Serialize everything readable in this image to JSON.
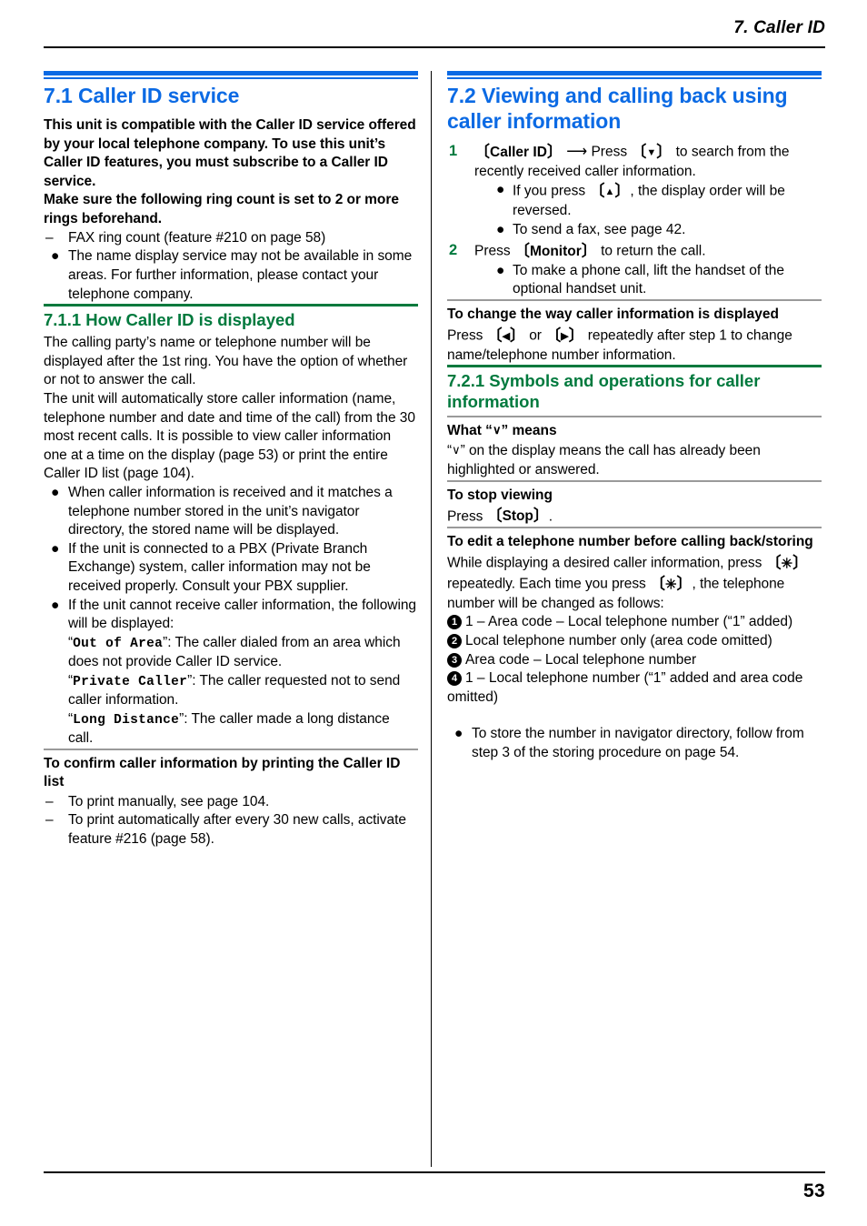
{
  "header": {
    "chapter": "7. Caller ID"
  },
  "footer": {
    "page_number": "53"
  },
  "colors": {
    "section_blue": "#0b6ae4",
    "subsection_green": "#00793d",
    "rule_gray": "#9a9a9a",
    "text_black": "#000000"
  },
  "left_column": {
    "section": {
      "title": "7.1 Caller ID service",
      "intro_bold_1": "This unit is compatible with the Caller ID service offered by your local telephone company. To use this unit’s Caller ID features, you must subscribe to a Caller ID service.",
      "intro_bold_2": "Make sure the following ring count is set to 2 or more rings beforehand.",
      "dash_item": "FAX ring count (feature #210 on page 58)",
      "bullet_item": "The name display service may not be available in some areas. For further information, please contact your telephone company."
    },
    "subsection": {
      "title": "7.1.1 How Caller ID is displayed",
      "para_1": "The calling party’s name or telephone number will be displayed after the 1st ring. You have the option of whether or not to answer the call.",
      "para_2": "The unit will automatically store caller information (name, telephone number and date and time of the call) from the 30 most recent calls. It is possible to view caller information one at a time on the display (page 53) or print the entire Caller ID list (page 104).",
      "bullets": [
        "When caller information is received and it matches a telephone number stored in the unit’s navigator directory, the stored name will be displayed.",
        "If the unit is connected to a PBX (Private Branch Exchange) system, caller information may not be received properly. Consult your PBX supplier."
      ],
      "bullet_3_lead": "If the unit cannot receive caller information, the following will be displayed:",
      "display_messages": [
        {
          "code": "Out of Area",
          "desc": "”: The caller dialed from an area which does not provide Caller ID service."
        },
        {
          "code": "Private Caller",
          "desc": "”: The caller requested not to send caller information."
        },
        {
          "code": "Long Distance",
          "desc": "”: The caller made a long distance call."
        }
      ]
    },
    "print_block": {
      "heading": "To confirm caller information by printing the Caller ID list",
      "items": [
        "To print manually, see page 104.",
        "To print automatically after every 30 new calls, activate feature #216 (page 58)."
      ]
    }
  },
  "right_column": {
    "section": {
      "title": "7.2 Viewing and calling back using caller information",
      "steps": [
        {
          "num": "1",
          "key_open": "〔",
          "key_label": "Caller ID",
          "key_close": "〕",
          "arrow": "⟶",
          "text_a": "Press",
          "key2_open": "〔",
          "key2_glyph": "▼",
          "key2_close": "〕",
          "text_b": "to search from the recently received caller information.",
          "sub_bullets": [
            {
              "pre": "If you press",
              "key_open": "〔",
              "key_glyph": "▲",
              "key_close": "〕",
              "post": ", the display order will be reversed."
            },
            {
              "pre": "To send a fax, see page 42.",
              "key_open": "",
              "key_glyph": "",
              "key_close": "",
              "post": ""
            }
          ]
        },
        {
          "num": "2",
          "pre": "Press",
          "key_open": "〔",
          "key_label": "Monitor",
          "key_close": "〕",
          "post": "to return the call.",
          "sub_bullets": [
            "To make a phone call, lift the handset of the optional handset unit."
          ]
        }
      ]
    },
    "change_display": {
      "heading": "To change the way caller information is displayed",
      "text_pre": "Press",
      "key1_open": "〔",
      "key1_glyph": "◀",
      "key1_close": "〕",
      "text_or": "or",
      "key2_open": "〔",
      "key2_glyph": "▶",
      "key2_close": "〕",
      "text_post": "repeatedly after step 1 to change name/telephone number information."
    },
    "subsection": {
      "title": "7.2.1 Symbols and operations for caller information",
      "what_check": {
        "heading_pre": "What “",
        "heading_glyph": "∨",
        "heading_post": "” means",
        "body_pre": "“",
        "body_glyph": "∨",
        "body_post": "” on the display means the call has already been highlighted or answered."
      },
      "stop_viewing": {
        "heading": "To stop viewing",
        "text_pre": "Press",
        "key_open": "〔",
        "key_label": "Stop",
        "key_close": "〕",
        "text_post": "."
      },
      "edit_number": {
        "heading": "To edit a telephone number before calling back/storing",
        "para_pre": "While displaying a desired caller information, press",
        "key1_open": "〔",
        "key1_glyph": "✳",
        "key1_close": "〕",
        "para_mid": "repeatedly. Each time you press",
        "key2_open": "〔",
        "key2_glyph": "✳",
        "key2_close": "〕",
        "para_post": ", the telephone number will be changed as follows:",
        "options": [
          {
            "num": "1",
            "text": "1 – Area code – Local telephone number (“1” added)"
          },
          {
            "num": "2",
            "text": "Local telephone number only (area code omitted)"
          },
          {
            "num": "3",
            "text": "Area code – Local telephone number"
          },
          {
            "num": "4",
            "text": "1 – Local telephone number (“1” added and area code omitted)"
          }
        ],
        "note": "To store the number in navigator directory, follow from step 3 of the storing procedure on page 54."
      }
    }
  }
}
